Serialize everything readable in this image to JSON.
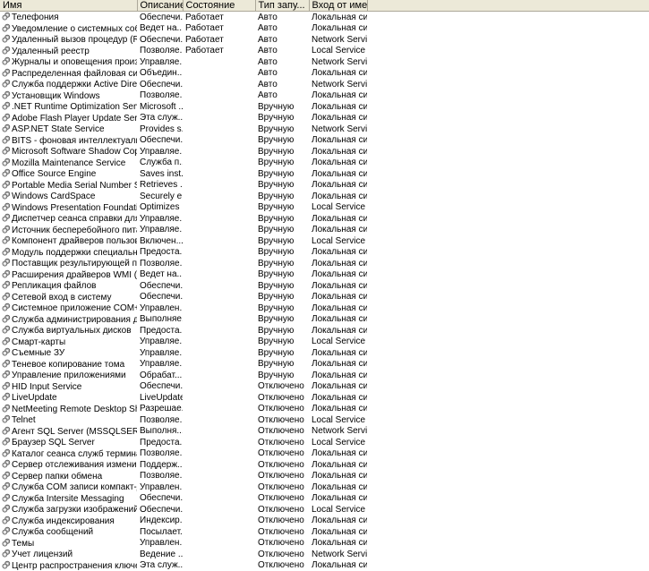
{
  "columns": {
    "name": "Имя",
    "description": "Описание",
    "state": "Состояние",
    "startup": "Тип запу...",
    "logon": "Вход от имени"
  },
  "services": [
    {
      "name": "Телефония",
      "desc": "Обеспечи...",
      "state": "Работает",
      "startup": "Авто",
      "logon": "Локальная сис..."
    },
    {
      "name": "Уведомление о системных событиях",
      "desc": "Ведет на...",
      "state": "Работает",
      "startup": "Авто",
      "logon": "Локальная сис..."
    },
    {
      "name": "Удаленный вызов процедур (RPC)",
      "desc": "Обеспечи...",
      "state": "Работает",
      "startup": "Авто",
      "logon": "Network Service"
    },
    {
      "name": "Удаленный реестр",
      "desc": "Позволяе...",
      "state": "Работает",
      "startup": "Авто",
      "logon": "Local Service"
    },
    {
      "name": "Журналы и оповещения производит...",
      "desc": "Управляе...",
      "state": "",
      "startup": "Авто",
      "logon": "Network Service"
    },
    {
      "name": "Распределенная файловая система ...",
      "desc": "Объедин...",
      "state": "",
      "startup": "Авто",
      "logon": "Локальная сис..."
    },
    {
      "name": "Служба поддержки Active Directory ...",
      "desc": "Обеспечи...",
      "state": "",
      "startup": "Авто",
      "logon": "Network Service"
    },
    {
      "name": "Установщик Windows",
      "desc": "Позволяе...",
      "state": "",
      "startup": "Авто",
      "logon": "Локальная сис..."
    },
    {
      "name": ".NET Runtime Optimization Service v2...",
      "desc": "Microsoft ...",
      "state": "",
      "startup": "Вручную",
      "logon": "Локальная сис..."
    },
    {
      "name": "Adobe Flash Player Update Service",
      "desc": "Эта служ...",
      "state": "",
      "startup": "Вручную",
      "logon": "Локальная сис..."
    },
    {
      "name": "ASP.NET State Service",
      "desc": "Provides s...",
      "state": "",
      "startup": "Вручную",
      "logon": "Network Service"
    },
    {
      "name": "BITS - фоновая интеллектуальная ...",
      "desc": "Обеспечи...",
      "state": "",
      "startup": "Вручную",
      "logon": "Локальная сис..."
    },
    {
      "name": "Microsoft Software Shadow Copy Provi...",
      "desc": "Управляе...",
      "state": "",
      "startup": "Вручную",
      "logon": "Локальная сис..."
    },
    {
      "name": "Mozilla Maintenance Service",
      "desc": "Служба п...",
      "state": "",
      "startup": "Вручную",
      "logon": "Локальная сис..."
    },
    {
      "name": "Office Source Engine",
      "desc": "Saves inst...",
      "state": "",
      "startup": "Вручную",
      "logon": "Локальная сис..."
    },
    {
      "name": "Portable Media Serial Number Service",
      "desc": "Retrieves ...",
      "state": "",
      "startup": "Вручную",
      "logon": "Локальная сис..."
    },
    {
      "name": "Windows CardSpace",
      "desc": "Securely e...",
      "state": "",
      "startup": "Вручную",
      "logon": "Локальная сис..."
    },
    {
      "name": "Windows Presentation Foundation Fon...",
      "desc": "Optimizes ...",
      "state": "",
      "startup": "Вручную",
      "logon": "Local Service"
    },
    {
      "name": "Диспетчер сеанса справки для удал...",
      "desc": "Управляе...",
      "state": "",
      "startup": "Вручную",
      "logon": "Локальная сис..."
    },
    {
      "name": "Источник бесперебойного питания",
      "desc": "Управляе...",
      "state": "",
      "startup": "Вручную",
      "logon": "Локальная сис..."
    },
    {
      "name": "Компонент драйверов пользовател...",
      "desc": "Включен...",
      "state": "",
      "startup": "Вручную",
      "logon": "Local Service"
    },
    {
      "name": "Модуль поддержки специальной ко...",
      "desc": "Предоста...",
      "state": "",
      "startup": "Вручную",
      "logon": "Локальная сис..."
    },
    {
      "name": "Поставщик результирующей полити...",
      "desc": "Позволяе...",
      "state": "",
      "startup": "Вручную",
      "logon": "Локальная сис..."
    },
    {
      "name": "Расширения драйверов WMI (Windo...",
      "desc": "Ведет на...",
      "state": "",
      "startup": "Вручную",
      "logon": "Локальная сис..."
    },
    {
      "name": "Репликация файлов",
      "desc": "Обеспечи...",
      "state": "",
      "startup": "Вручную",
      "logon": "Локальная сис..."
    },
    {
      "name": "Сетевой вход в систему",
      "desc": "Обеспечи...",
      "state": "",
      "startup": "Вручную",
      "logon": "Локальная сис..."
    },
    {
      "name": "Системное приложение COM+",
      "desc": "Управлен...",
      "state": "",
      "startup": "Вручную",
      "logon": "Локальная сис..."
    },
    {
      "name": "Служба администрирования диспет...",
      "desc": "Выполняе...",
      "state": "",
      "startup": "Вручную",
      "logon": "Локальная сис..."
    },
    {
      "name": "Служба виртуальных дисков",
      "desc": "Предоста...",
      "state": "",
      "startup": "Вручную",
      "logon": "Локальная сис..."
    },
    {
      "name": "Смарт-карты",
      "desc": "Управляе...",
      "state": "",
      "startup": "Вручную",
      "logon": "Local Service"
    },
    {
      "name": "Съемные ЗУ",
      "desc": "Управляе...",
      "state": "",
      "startup": "Вручную",
      "logon": "Локальная сис..."
    },
    {
      "name": "Теневое копирование тома",
      "desc": "Управляе...",
      "state": "",
      "startup": "Вручную",
      "logon": "Локальная сис..."
    },
    {
      "name": "Управление приложениями",
      "desc": "Обрабат...",
      "state": "",
      "startup": "Вручную",
      "logon": "Локальная сис..."
    },
    {
      "name": "HID Input Service",
      "desc": "Обеспечи...",
      "state": "",
      "startup": "Отключено",
      "logon": "Локальная сис..."
    },
    {
      "name": "LiveUpdate",
      "desc": "LiveUpdate",
      "state": "",
      "startup": "Отключено",
      "logon": "Локальная сис..."
    },
    {
      "name": "NetMeeting Remote Desktop Sharing",
      "desc": "Разрешае...",
      "state": "",
      "startup": "Отключено",
      "logon": "Локальная сис..."
    },
    {
      "name": "Telnet",
      "desc": "Позволяе...",
      "state": "",
      "startup": "Отключено",
      "logon": "Local Service"
    },
    {
      "name": "Агент SQL Server (MSSQLSERVER)",
      "desc": "Выполня...",
      "state": "",
      "startup": "Отключено",
      "logon": "Network Service"
    },
    {
      "name": "Браузер SQL Server",
      "desc": "Предоста...",
      "state": "",
      "startup": "Отключено",
      "logon": "Local Service"
    },
    {
      "name": "Каталог сеанса служб терминалов",
      "desc": "Позволяе...",
      "state": "",
      "startup": "Отключено",
      "logon": "Локальная сис..."
    },
    {
      "name": "Сервер отслеживания изменившихся...",
      "desc": "Поддерж...",
      "state": "",
      "startup": "Отключено",
      "logon": "Локальная сис..."
    },
    {
      "name": "Сервер папки обмена",
      "desc": "Позволяе...",
      "state": "",
      "startup": "Отключено",
      "logon": "Локальная сис..."
    },
    {
      "name": "Служба COM записи компакт-дисков...",
      "desc": "Управлен...",
      "state": "",
      "startup": "Отключено",
      "logon": "Локальная сис..."
    },
    {
      "name": "Служба Intersite Messaging",
      "desc": "Обеспечи...",
      "state": "",
      "startup": "Отключено",
      "logon": "Локальная сис..."
    },
    {
      "name": "Служба загрузки изображений (WIA)",
      "desc": "Обеспечи...",
      "state": "",
      "startup": "Отключено",
      "logon": "Local Service"
    },
    {
      "name": "Служба индексирования",
      "desc": "Индексир...",
      "state": "",
      "startup": "Отключено",
      "logon": "Локальная сис..."
    },
    {
      "name": "Служба сообщений",
      "desc": "Посылает...",
      "state": "",
      "startup": "Отключено",
      "logon": "Локальная сис..."
    },
    {
      "name": "Темы",
      "desc": "Управлен...",
      "state": "",
      "startup": "Отключено",
      "logon": "Локальная сис..."
    },
    {
      "name": "Учет лицензий",
      "desc": "Ведение ...",
      "state": "",
      "startup": "Отключено",
      "logon": "Network Service"
    },
    {
      "name": "Центр распространения ключей Ker...",
      "desc": "Эта служ...",
      "state": "",
      "startup": "Отключено",
      "logon": "Локальная сис..."
    }
  ],
  "icons": {
    "service_icon": "gears-icon"
  }
}
